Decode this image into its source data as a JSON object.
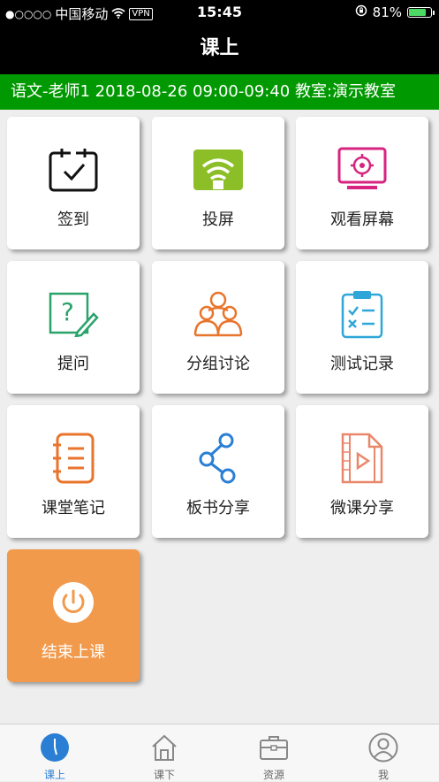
{
  "status": {
    "carrier": "中国移动",
    "vpn": "VPN",
    "time": "15:45",
    "battery": "81%",
    "battery_level": 0.81
  },
  "header": {
    "title": "课上"
  },
  "lesson_info": "语文-老师1 2018-08-26 09:00-09:40 教室:演示教室",
  "tiles": [
    {
      "label": "签到",
      "icon": "calendar-check-icon"
    },
    {
      "label": "投屏",
      "icon": "cast-screen-icon"
    },
    {
      "label": "观看屏幕",
      "icon": "monitor-target-icon"
    },
    {
      "label": "提问",
      "icon": "question-pencil-icon"
    },
    {
      "label": "分组讨论",
      "icon": "group-people-icon"
    },
    {
      "label": "测试记录",
      "icon": "clipboard-check-icon"
    },
    {
      "label": "课堂笔记",
      "icon": "notebook-icon"
    },
    {
      "label": "板书分享",
      "icon": "share-nodes-icon"
    },
    {
      "label": "微课分享",
      "icon": "video-file-icon"
    },
    {
      "label": "结束上课",
      "icon": "power-icon"
    }
  ],
  "tabbar": [
    {
      "label": "课上",
      "icon": "clock-icon",
      "active": true
    },
    {
      "label": "课下",
      "icon": "home-icon",
      "active": false
    },
    {
      "label": "资源",
      "icon": "briefcase-icon",
      "active": false
    },
    {
      "label": "我",
      "icon": "user-icon",
      "active": false
    }
  ],
  "colors": {
    "info_bar": "#019901",
    "end_class_tile": "#f29a4c",
    "active_tab": "#2a7fd4"
  }
}
